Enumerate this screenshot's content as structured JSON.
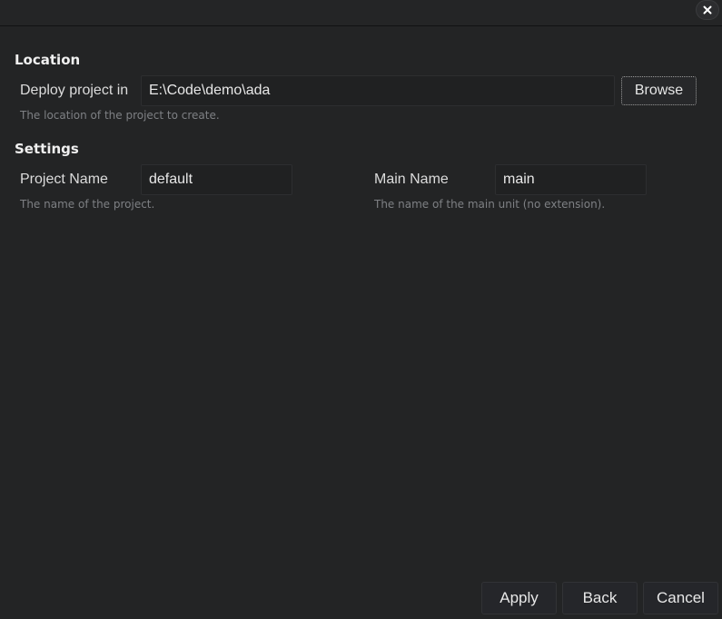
{
  "window": {
    "close_icon": "close-icon"
  },
  "location": {
    "section_title": "Location",
    "deploy_label": "Deploy project in",
    "deploy_value": "E:\\Code\\demo\\ada",
    "browse_label": "Browse",
    "hint": "The location of the project to create."
  },
  "settings": {
    "section_title": "Settings",
    "project_name_label": "Project Name",
    "project_name_value": "default",
    "project_name_hint": "The name of the project.",
    "main_name_label": "Main Name",
    "main_name_value": "main",
    "main_name_hint": "The name of the main unit (no extension)."
  },
  "footer": {
    "apply_label": "Apply",
    "back_label": "Back",
    "cancel_label": "Cancel"
  }
}
